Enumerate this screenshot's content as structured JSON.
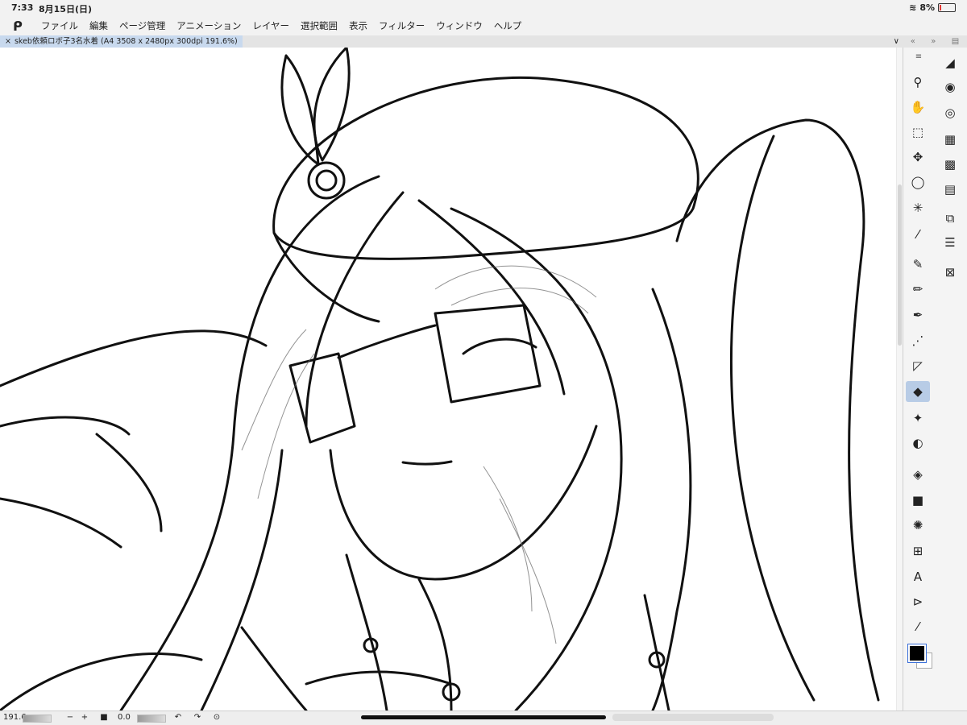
{
  "status": {
    "time": "7:33",
    "date": "8月15日(日)",
    "battery": "8%"
  },
  "menu": {
    "logo": "ᑭ",
    "items": [
      "ファイル",
      "編集",
      "ページ管理",
      "アニメーション",
      "レイヤー",
      "選択範囲",
      "表示",
      "フィルター",
      "ウィンドウ",
      "ヘルプ"
    ]
  },
  "tab": {
    "close": "×",
    "title": "skeb依頼ロボ子3名水着 (A4 3508 x 2480px 300dpi 191.6%)",
    "collapse": "∨"
  },
  "right_header": [
    "«",
    "»",
    "▤"
  ],
  "tools": [
    {
      "name": "sub-tool-menu-icon",
      "glyph": "≡"
    },
    {
      "name": "zoom-icon",
      "glyph": "⚲"
    },
    {
      "name": "hand-icon",
      "glyph": "✋"
    },
    {
      "name": "object-icon",
      "glyph": "⬚"
    },
    {
      "name": "move-icon",
      "glyph": "✥"
    },
    {
      "name": "lasso-icon",
      "glyph": "◯"
    },
    {
      "name": "magic-wand-icon",
      "glyph": "✳"
    },
    {
      "name": "eyedropper-icon",
      "glyph": "⁄"
    },
    {
      "name": "pen-icon",
      "glyph": "✎"
    },
    {
      "name": "pencil-icon",
      "glyph": "✏"
    },
    {
      "name": "brush-icon",
      "glyph": "✒"
    },
    {
      "name": "airbrush-icon",
      "glyph": "⋰"
    },
    {
      "name": "decoration-icon",
      "glyph": "◸"
    },
    {
      "name": "eraser-icon",
      "glyph": "◆"
    },
    {
      "name": "sparkle-icon",
      "glyph": "✦"
    },
    {
      "name": "blend-icon",
      "glyph": "◐"
    },
    {
      "name": "fill-icon",
      "glyph": "◈"
    },
    {
      "name": "gradient-icon",
      "glyph": "■"
    },
    {
      "name": "figure-icon",
      "glyph": "✺"
    },
    {
      "name": "frame-icon",
      "glyph": "⊞"
    },
    {
      "name": "text-icon",
      "glyph": "A"
    },
    {
      "name": "balloon-icon",
      "glyph": "⊳"
    },
    {
      "name": "ruler-pen-icon",
      "glyph": "⁄"
    }
  ],
  "palettes": [
    {
      "name": "tool-property-icon",
      "glyph": "◢"
    },
    {
      "name": "brush-size-icon",
      "glyph": "◉"
    },
    {
      "name": "color-circle-icon",
      "glyph": "◎"
    },
    {
      "name": "color-set-icon",
      "glyph": "▦"
    },
    {
      "name": "intermediate-color-icon",
      "glyph": "▩"
    },
    {
      "name": "timeline-icon",
      "glyph": "▤"
    },
    {
      "name": "layer-property-icon",
      "glyph": "⧉"
    },
    {
      "name": "layer-icon",
      "glyph": "☰"
    },
    {
      "name": "navigator-icon",
      "glyph": "⊠"
    }
  ],
  "color": {
    "main": "#000000",
    "sub": "#ffffff"
  },
  "bottom": {
    "zoom": "191.6",
    "minus": "−",
    "plus": "+",
    "angle": "0.0",
    "fit": "■",
    "rot_left": "↶",
    "rot_right": "↷",
    "reset": "⊙"
  }
}
